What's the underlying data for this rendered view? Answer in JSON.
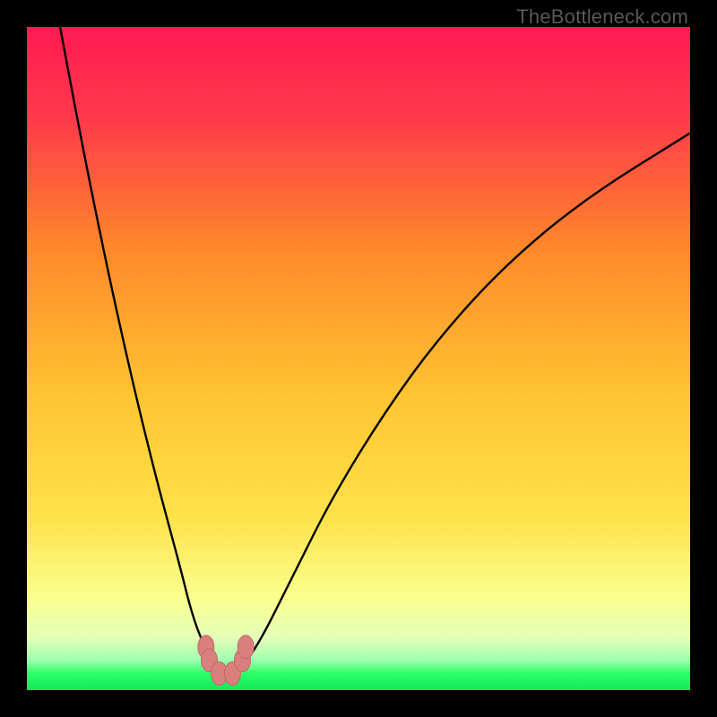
{
  "watermark": "TheBottleneck.com",
  "colors": {
    "frame": "#000000",
    "gradient_top": "#ff1a52",
    "gradient_mid1": "#ff8a2a",
    "gradient_mid2": "#ffe24a",
    "gradient_low": "#faff8e",
    "gradient_green": "#2bff66",
    "curve_stroke": "#000000",
    "marker_fill": "#d97f7e",
    "marker_stroke": "#c36a69"
  },
  "chart_data": {
    "type": "line",
    "title": "",
    "xlabel": "",
    "ylabel": "",
    "xlim": [
      0,
      100
    ],
    "ylim": [
      0,
      100
    ],
    "series": [
      {
        "name": "bottleneck-curve",
        "x": [
          5,
          8,
          11,
          14,
          17,
          20,
          23,
          25,
          27,
          28.5,
          30,
          32,
          35,
          40,
          46,
          54,
          62,
          72,
          84,
          100
        ],
        "y": [
          100,
          84,
          69,
          55,
          42,
          30,
          19,
          11,
          6,
          3,
          2,
          3,
          7,
          17,
          29,
          42,
          53,
          64,
          74,
          84
        ]
      }
    ],
    "optimum_x": 30,
    "optimum_y": 2,
    "markers": [
      {
        "x": 27.0,
        "y": 6.5
      },
      {
        "x": 27.5,
        "y": 4.5
      },
      {
        "x": 29.0,
        "y": 2.5
      },
      {
        "x": 31.0,
        "y": 2.5
      },
      {
        "x": 32.5,
        "y": 4.5
      },
      {
        "x": 33.0,
        "y": 6.5
      }
    ],
    "gradient_stops": [
      {
        "pct": 0,
        "meaning": "severe-bottleneck",
        "color": "#ff1a52"
      },
      {
        "pct": 40,
        "meaning": "high-bottleneck",
        "color": "#ff8a2a"
      },
      {
        "pct": 70,
        "meaning": "moderate-bottleneck",
        "color": "#ffe24a"
      },
      {
        "pct": 88,
        "meaning": "minor-bottleneck",
        "color": "#faff8e"
      },
      {
        "pct": 97,
        "meaning": "no-bottleneck",
        "color": "#2bff66"
      }
    ]
  }
}
